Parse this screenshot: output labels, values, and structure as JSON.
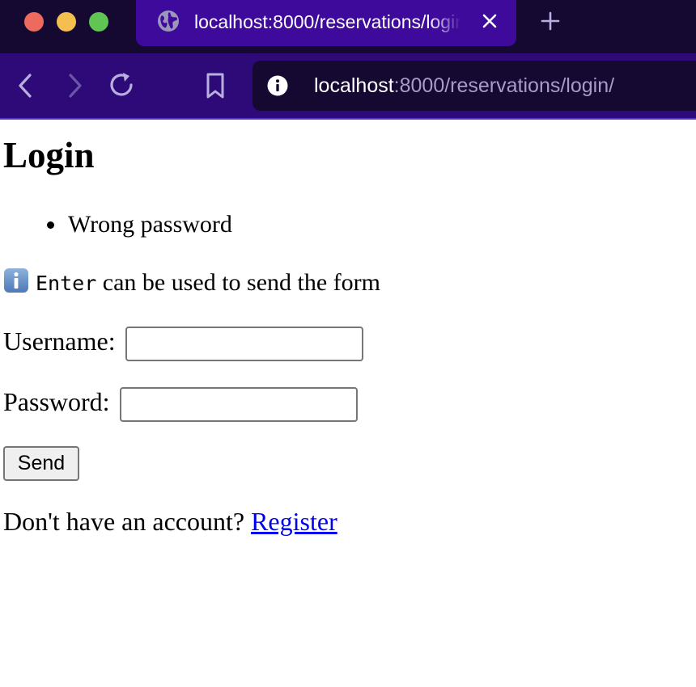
{
  "colors": {
    "tabbar_bg": "#150932",
    "active_tab_bg": "#3e0a9c",
    "navbar_bg": "#2d0a78",
    "link": "#0000ee"
  },
  "browser": {
    "tab": {
      "title": "localhost:8000/reservations/login/",
      "icon": "globe-icon"
    },
    "controls": [
      "back-icon",
      "forward-icon",
      "reload-icon",
      "bookmark-icon",
      "info-icon",
      "close-icon",
      "plus-icon"
    ],
    "address": {
      "host": "localhost",
      "rest": ":8000/reservations/login/"
    }
  },
  "page": {
    "title": "Login",
    "errors": [
      "Wrong password"
    ],
    "hint": {
      "icon": "info-emoji-icon",
      "key": "Enter",
      "text": " can be used to send the form"
    },
    "form": {
      "username_label": "Username:",
      "username_value": "",
      "password_label": "Password:",
      "password_value": "",
      "submit_label": "Send"
    },
    "footer": {
      "text": "Don't have an account? ",
      "link_label": "Register"
    }
  }
}
